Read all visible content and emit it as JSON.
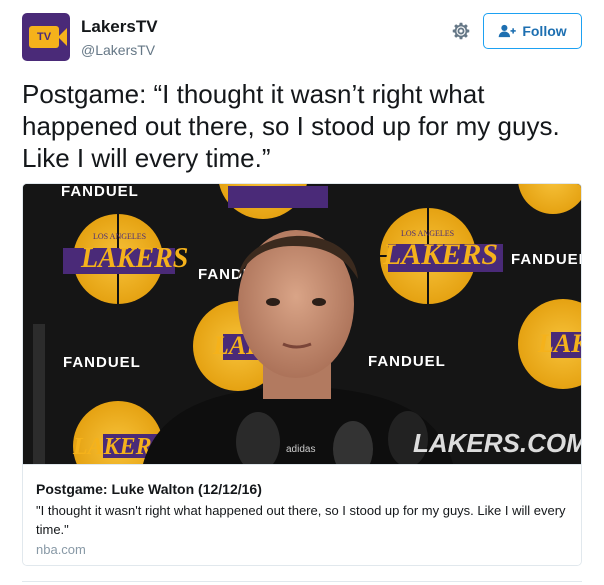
{
  "colors": {
    "accent": "#1da1f2",
    "lakers_purple": "#4a2a78",
    "lakers_gold": "#f5b21b"
  },
  "user": {
    "display_name": "LakersTV",
    "screen_name": "@LakersTV",
    "avatar_text": "TV",
    "avatar_icon": "lakers-tv-logo"
  },
  "actions": {
    "settings_icon": "gear-icon",
    "follow_label": "Follow",
    "follow_icon": "add-user-icon"
  },
  "tweet": {
    "text": "Postgame: “I thought it wasn’t right what happened out there, so I stood up for my guys. Like I will every time.”"
  },
  "card": {
    "media": {
      "backdrop_sponsor": "FANDUEL",
      "backdrop_team_top": "LOS ANGELES",
      "backdrop_team": "LAKERS",
      "watermark": "LAKERS.COM",
      "shirt_logo": "adidas"
    },
    "title": "Postgame: Luke Walton (12/12/16)",
    "description": "\"I thought it wasn't right what happened out there, so I stood up for my guys. Like I will every time.\"",
    "domain": "nba.com"
  }
}
